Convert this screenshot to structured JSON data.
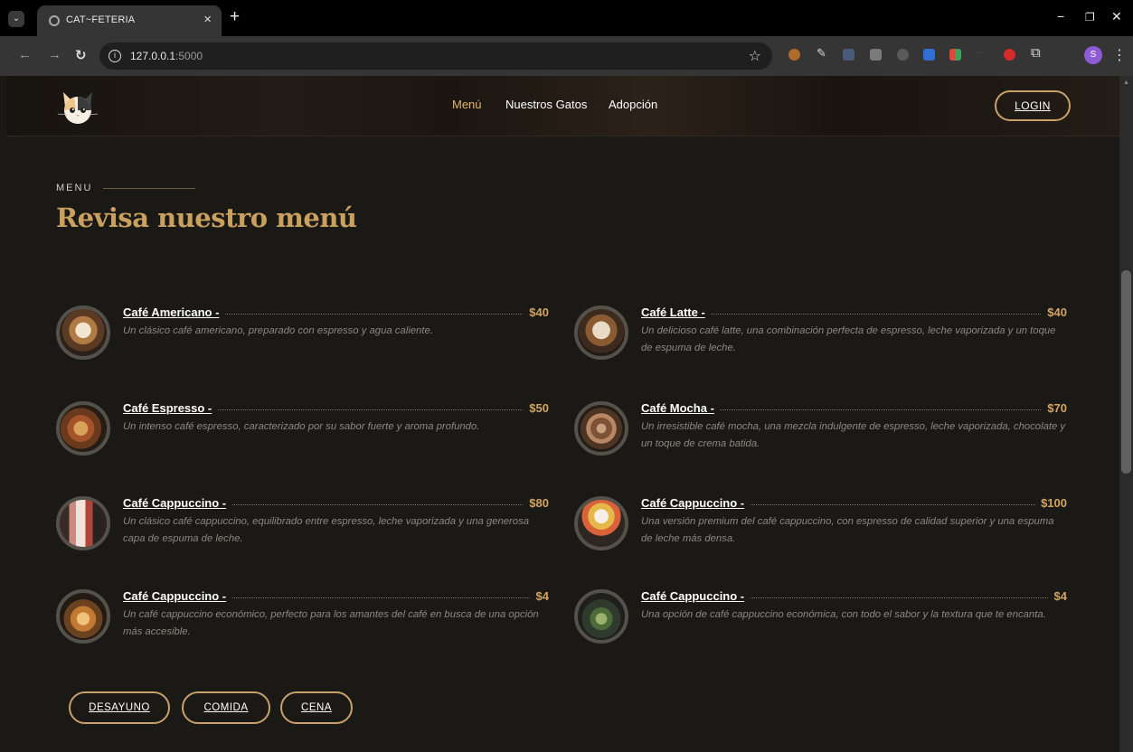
{
  "browser": {
    "tab_title": "CAT~FETERIA",
    "url_host": "127.0.0.1",
    "url_port": ":5000"
  },
  "header": {
    "nav": [
      {
        "label": "Menú",
        "active": true
      },
      {
        "label": "Nuestros Gatos",
        "active": false
      },
      {
        "label": "Adopción",
        "active": false
      }
    ],
    "login_label": "LOGIN"
  },
  "section": {
    "eyebrow": "MENU",
    "title": "Revisa nuestro menú"
  },
  "menu_items": [
    {
      "name": "Café Americano -",
      "price": "$40",
      "description": "Un clásico café americano, preparado con espresso y agua caliente."
    },
    {
      "name": "Café Latte -",
      "price": "$40",
      "description": "Un delicioso café latte, una combinación perfecta de espresso, leche vaporizada y un toque de espuma de leche."
    },
    {
      "name": "Café Espresso -",
      "price": "$50",
      "description": "Un intenso café espresso, caracterizado por su sabor fuerte y aroma profundo."
    },
    {
      "name": "Café Mocha -",
      "price": "$70",
      "description": "Un irresistible café mocha, una mezcla indulgente de espresso, leche vaporizada, chocolate y un toque de crema batida."
    },
    {
      "name": "Café Cappuccino -",
      "price": "$80",
      "description": "Un clásico café cappuccino, equilibrado entre espresso, leche vaporizada y una generosa capa de espuma de leche."
    },
    {
      "name": "Café Cappuccino -",
      "price": "$100",
      "description": "Una versión premium del café cappuccino, con espresso de calidad superior y una espuma de leche más densa."
    },
    {
      "name": "Café Cappuccino -",
      "price": "$4",
      "description": "Un café cappuccino económico, perfecto para los amantes del café en busca de una opción más accesible."
    },
    {
      "name": "Café Cappuccino -",
      "price": "$4",
      "description": "Una opción de café cappuccino económica, con todo el sabor y la textura que te encanta."
    }
  ],
  "categories": [
    "DESAYUNO",
    "COMIDA",
    "CENA"
  ],
  "colors": {
    "accent_gold": "#c9a05e",
    "background": "#1b1916",
    "description_text": "#8d8780"
  }
}
